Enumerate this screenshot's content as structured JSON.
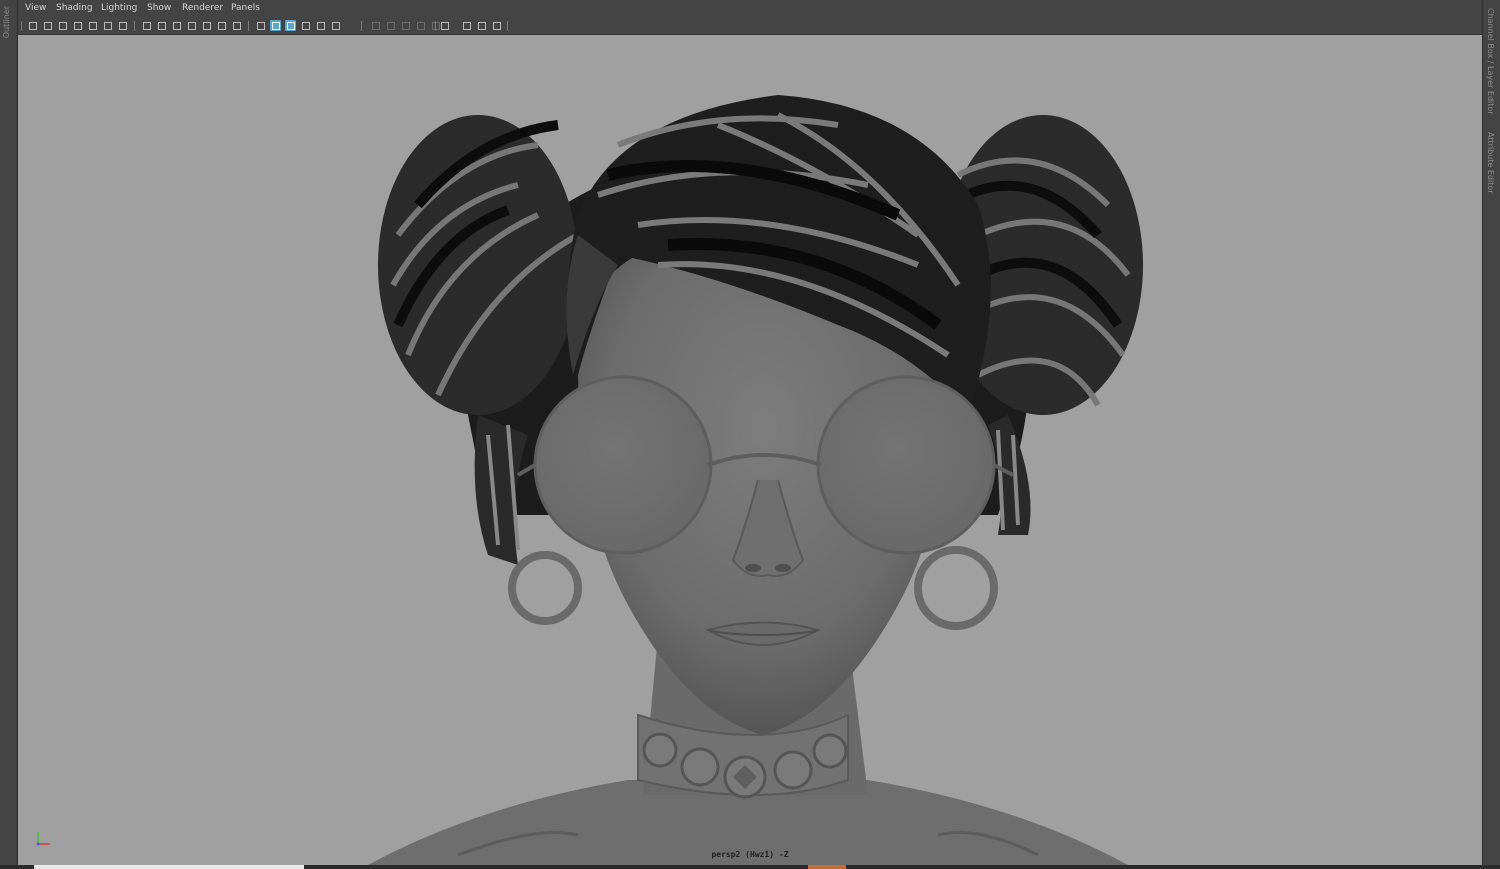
{
  "left_panel": {
    "label": "Outliner"
  },
  "right_panel": {
    "labels": [
      "Channel Box / Layer Editor",
      "Attribute Editor"
    ]
  },
  "menu": {
    "items": [
      "View",
      "Shading",
      "Lighting",
      "Show",
      "Renderer",
      "Panels"
    ]
  },
  "toolbar": {
    "icons": [
      "camera-attributes-icon",
      "camera-select-icon",
      "camera-lock-icon",
      "bookmark-icon",
      "image-plane-icon",
      "2d-pan-zoom-icon",
      "grease-pencil-icon",
      "grid-icon",
      "film-gate-icon",
      "resolution-gate-icon",
      "gate-mask-icon",
      "field-chart-icon",
      "safe-action-icon",
      "safe-title-icon",
      "wireframe-icon",
      "smooth-shade-icon",
      "default-material-icon",
      "xray-icon",
      "textured-icon",
      "use-all-lights-icon",
      "shadows-icon",
      "screen-space-ao-icon",
      "motion-blur-icon",
      "multisample-aa-icon",
      "depth-of-field-icon",
      "isolate-select-icon",
      "xray-joints-icon",
      "xray-active-components-icon",
      "two-pane-icon",
      "single-pane-icon"
    ],
    "active": [
      "smooth-shade-icon",
      "default-material-icon"
    ]
  },
  "viewport": {
    "camera_label": "persp2 (Hwz1) -Z",
    "background_color": "#a0a0a0",
    "axis": {
      "x_color": "#d04040",
      "y_color": "#40c040",
      "z_color": "#4060d0"
    }
  }
}
